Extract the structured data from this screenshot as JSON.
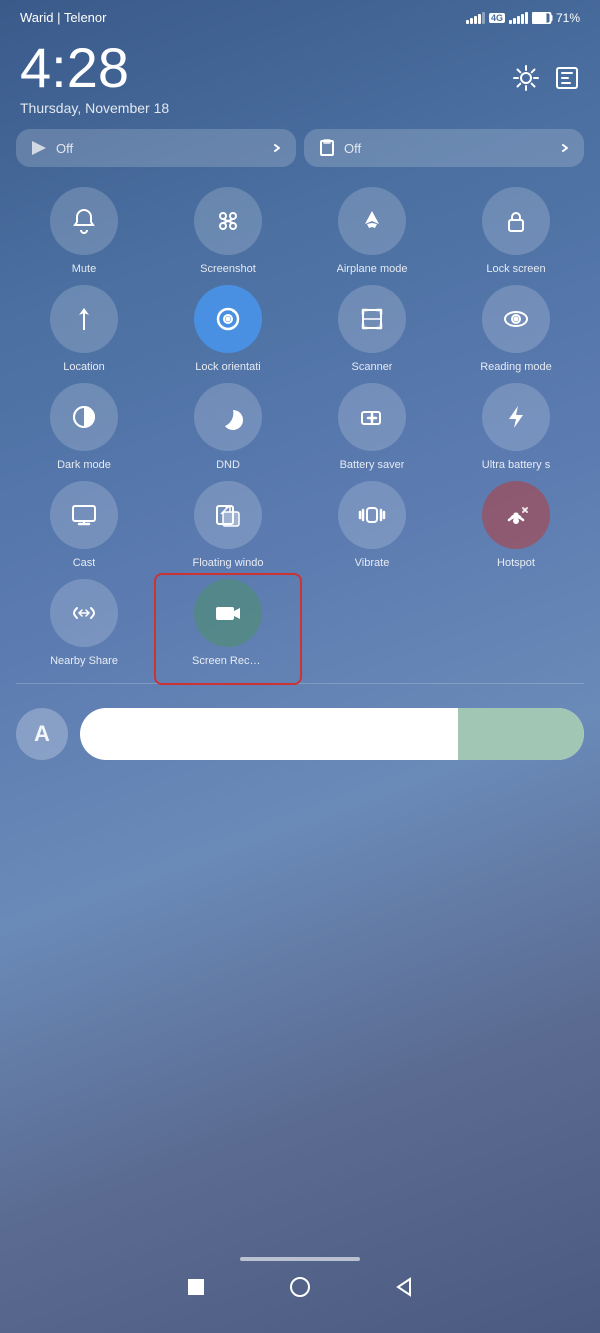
{
  "status": {
    "carrier": "Warid | Telenor",
    "battery_percent": "71%",
    "time": "4:28",
    "date": "Thursday, November 18"
  },
  "top_tiles": [
    {
      "icon": "▶",
      "label": "Off"
    },
    {
      "icon": "📋",
      "label": "Off"
    }
  ],
  "tiles": [
    {
      "id": "mute",
      "label": "Mute",
      "active": false
    },
    {
      "id": "screenshot",
      "label": "Screenshot",
      "active": false
    },
    {
      "id": "airplane",
      "label": "Airplane mode",
      "active": false
    },
    {
      "id": "lock-screen",
      "label": "Lock screen",
      "active": false
    },
    {
      "id": "location",
      "label": "Location",
      "active": false
    },
    {
      "id": "lock-orientation",
      "label": "Lock orientati",
      "active": true
    },
    {
      "id": "scanner",
      "label": "Scanner",
      "active": false
    },
    {
      "id": "reading-mode",
      "label": "Reading mode",
      "active": false
    },
    {
      "id": "dark-mode",
      "label": "Dark mode",
      "active": false
    },
    {
      "id": "dnd",
      "label": "DND",
      "active": false
    },
    {
      "id": "battery-saver",
      "label": "Battery saver",
      "active": false
    },
    {
      "id": "ultra-battery",
      "label": "Ultra battery s",
      "active": false
    },
    {
      "id": "cast",
      "label": "Cast",
      "active": false
    },
    {
      "id": "floating-window",
      "label": "Floating windo",
      "active": false
    },
    {
      "id": "vibrate",
      "label": "Vibrate",
      "active": false
    },
    {
      "id": "hotspot",
      "label": "Hotspot",
      "active": false,
      "special": "hotspot"
    },
    {
      "id": "nearby-share",
      "label": "Nearby Share",
      "active": false
    },
    {
      "id": "screen-record",
      "label": "Screen Record",
      "active": true,
      "special": "screen-record"
    }
  ],
  "brightness": {
    "avatar_letter": "A",
    "level": 0.75
  },
  "nav": {
    "square_label": "■",
    "circle_label": "○",
    "back_label": "◀"
  }
}
